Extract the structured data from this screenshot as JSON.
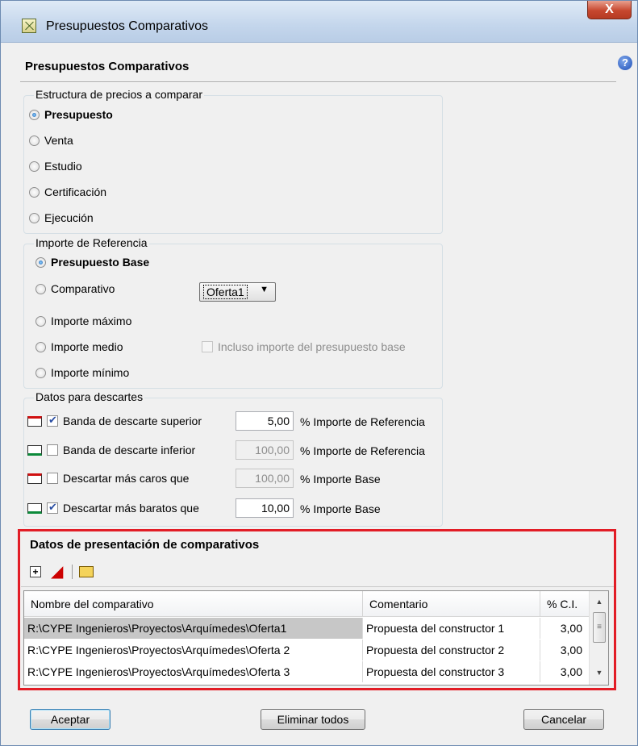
{
  "window": {
    "title": "Presupuestos Comparativos",
    "close_label": "X",
    "help_label": "?"
  },
  "header": {
    "title": "Presupuestos Comparativos"
  },
  "price_structure": {
    "legend": "Estructura de precios a comparar",
    "options": [
      "Presupuesto",
      "Venta",
      "Estudio",
      "Certificación",
      "Ejecución"
    ],
    "selected": "Presupuesto"
  },
  "reference": {
    "legend": "Importe de Referencia",
    "options": [
      "Presupuesto Base",
      "Comparativo",
      "Importe máximo",
      "Importe medio",
      "Importe mínimo"
    ],
    "selected": "Presupuesto Base",
    "comparativo_dropdown": "Oferta1",
    "include_base_label": "Incluso importe del presupuesto base",
    "include_base_checked": false
  },
  "discards": {
    "legend": "Datos para descartes",
    "rows": [
      {
        "label": "Banda de descarte superior",
        "checked": true,
        "value": "5,00",
        "unit": "% Importe de Referencia",
        "band_color": "#d01010"
      },
      {
        "label": "Banda de descarte inferior",
        "checked": false,
        "value": "100,00",
        "unit": "% Importe de Referencia",
        "band_color": "#0c8a3a"
      },
      {
        "label": "Descartar más caros que",
        "checked": false,
        "value": "100,00",
        "unit": "% Importe Base",
        "band_color": "#d01010"
      },
      {
        "label": "Descartar más baratos que",
        "checked": true,
        "value": "10,00",
        "unit": "% Importe Base",
        "band_color": "#0c8a3a"
      }
    ]
  },
  "presentation": {
    "title": "Datos de presentación de comparativos",
    "highlight_color": "#e21d26",
    "columns": [
      "Nombre del comparativo",
      "Comentario",
      "% C.I."
    ],
    "rows": [
      {
        "name": "R:\\CYPE Ingenieros\\Proyectos\\Arquímedes\\Oferta1",
        "comment": "Propuesta del constructor 1",
        "ci": "3,00"
      },
      {
        "name": "R:\\CYPE Ingenieros\\Proyectos\\Arquímedes\\Oferta 2",
        "comment": "Propuesta del constructor 2",
        "ci": "3,00"
      },
      {
        "name": "R:\\CYPE Ingenieros\\Proyectos\\Arquímedes\\Oferta 3",
        "comment": "Propuesta del constructor 3",
        "ci": "3,00"
      }
    ]
  },
  "buttons": {
    "accept": "Aceptar",
    "delete_all": "Eliminar todos",
    "cancel": "Cancelar"
  }
}
